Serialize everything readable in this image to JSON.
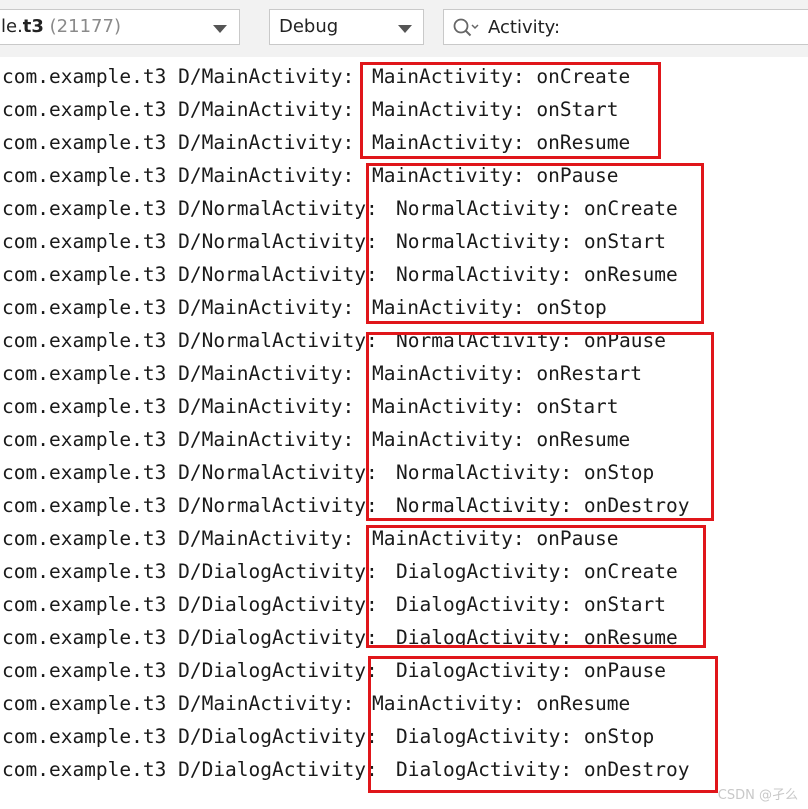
{
  "toolbar": {
    "process_prefix": "le.",
    "process_bold": "t3",
    "process_pid": " (21177)",
    "log_level": "Debug",
    "search_value": "Activity:",
    "dropdown_icon": "chevron-down-icon",
    "search_icon": "magnifier-icon"
  },
  "log_lines": [
    {
      "tag": "com.example.t3 D/MainActivity:",
      "msg": "MainActivity: onCreate"
    },
    {
      "tag": "com.example.t3 D/MainActivity:",
      "msg": "MainActivity: onStart"
    },
    {
      "tag": "com.example.t3 D/MainActivity:",
      "msg": "MainActivity: onResume"
    },
    {
      "tag": "com.example.t3 D/MainActivity:",
      "msg": "MainActivity: onPause"
    },
    {
      "tag": "com.example.t3 D/NormalActivity:",
      "msg": "NormalActivity: onCreate"
    },
    {
      "tag": "com.example.t3 D/NormalActivity:",
      "msg": "NormalActivity: onStart"
    },
    {
      "tag": "com.example.t3 D/NormalActivity:",
      "msg": "NormalActivity: onResume"
    },
    {
      "tag": "com.example.t3 D/MainActivity:",
      "msg": "MainActivity: onStop"
    },
    {
      "tag": "com.example.t3 D/NormalActivity:",
      "msg": "NormalActivity: onPause"
    },
    {
      "tag": "com.example.t3 D/MainActivity:",
      "msg": "MainActivity: onRestart"
    },
    {
      "tag": "com.example.t3 D/MainActivity:",
      "msg": "MainActivity: onStart"
    },
    {
      "tag": "com.example.t3 D/MainActivity:",
      "msg": "MainActivity: onResume"
    },
    {
      "tag": "com.example.t3 D/NormalActivity:",
      "msg": "NormalActivity: onStop"
    },
    {
      "tag": "com.example.t3 D/NormalActivity:",
      "msg": "NormalActivity: onDestroy"
    },
    {
      "tag": "com.example.t3 D/MainActivity:",
      "msg": "MainActivity: onPause"
    },
    {
      "tag": "com.example.t3 D/DialogActivity:",
      "msg": "DialogActivity: onCreate"
    },
    {
      "tag": "com.example.t3 D/DialogActivity:",
      "msg": "DialogActivity: onStart"
    },
    {
      "tag": "com.example.t3 D/DialogActivity:",
      "msg": "DialogActivity: onResume"
    },
    {
      "tag": "com.example.t3 D/DialogActivity:",
      "msg": "DialogActivity: onPause"
    },
    {
      "tag": "com.example.t3 D/MainActivity:",
      "msg": "MainActivity: onResume"
    },
    {
      "tag": "com.example.t3 D/DialogActivity:",
      "msg": "DialogActivity: onStop"
    },
    {
      "tag": "com.example.t3 D/DialogActivity:",
      "msg": "DialogActivity: onDestroy"
    }
  ],
  "highlight_color": "#e0161a",
  "watermark": "CSDN @孑么"
}
